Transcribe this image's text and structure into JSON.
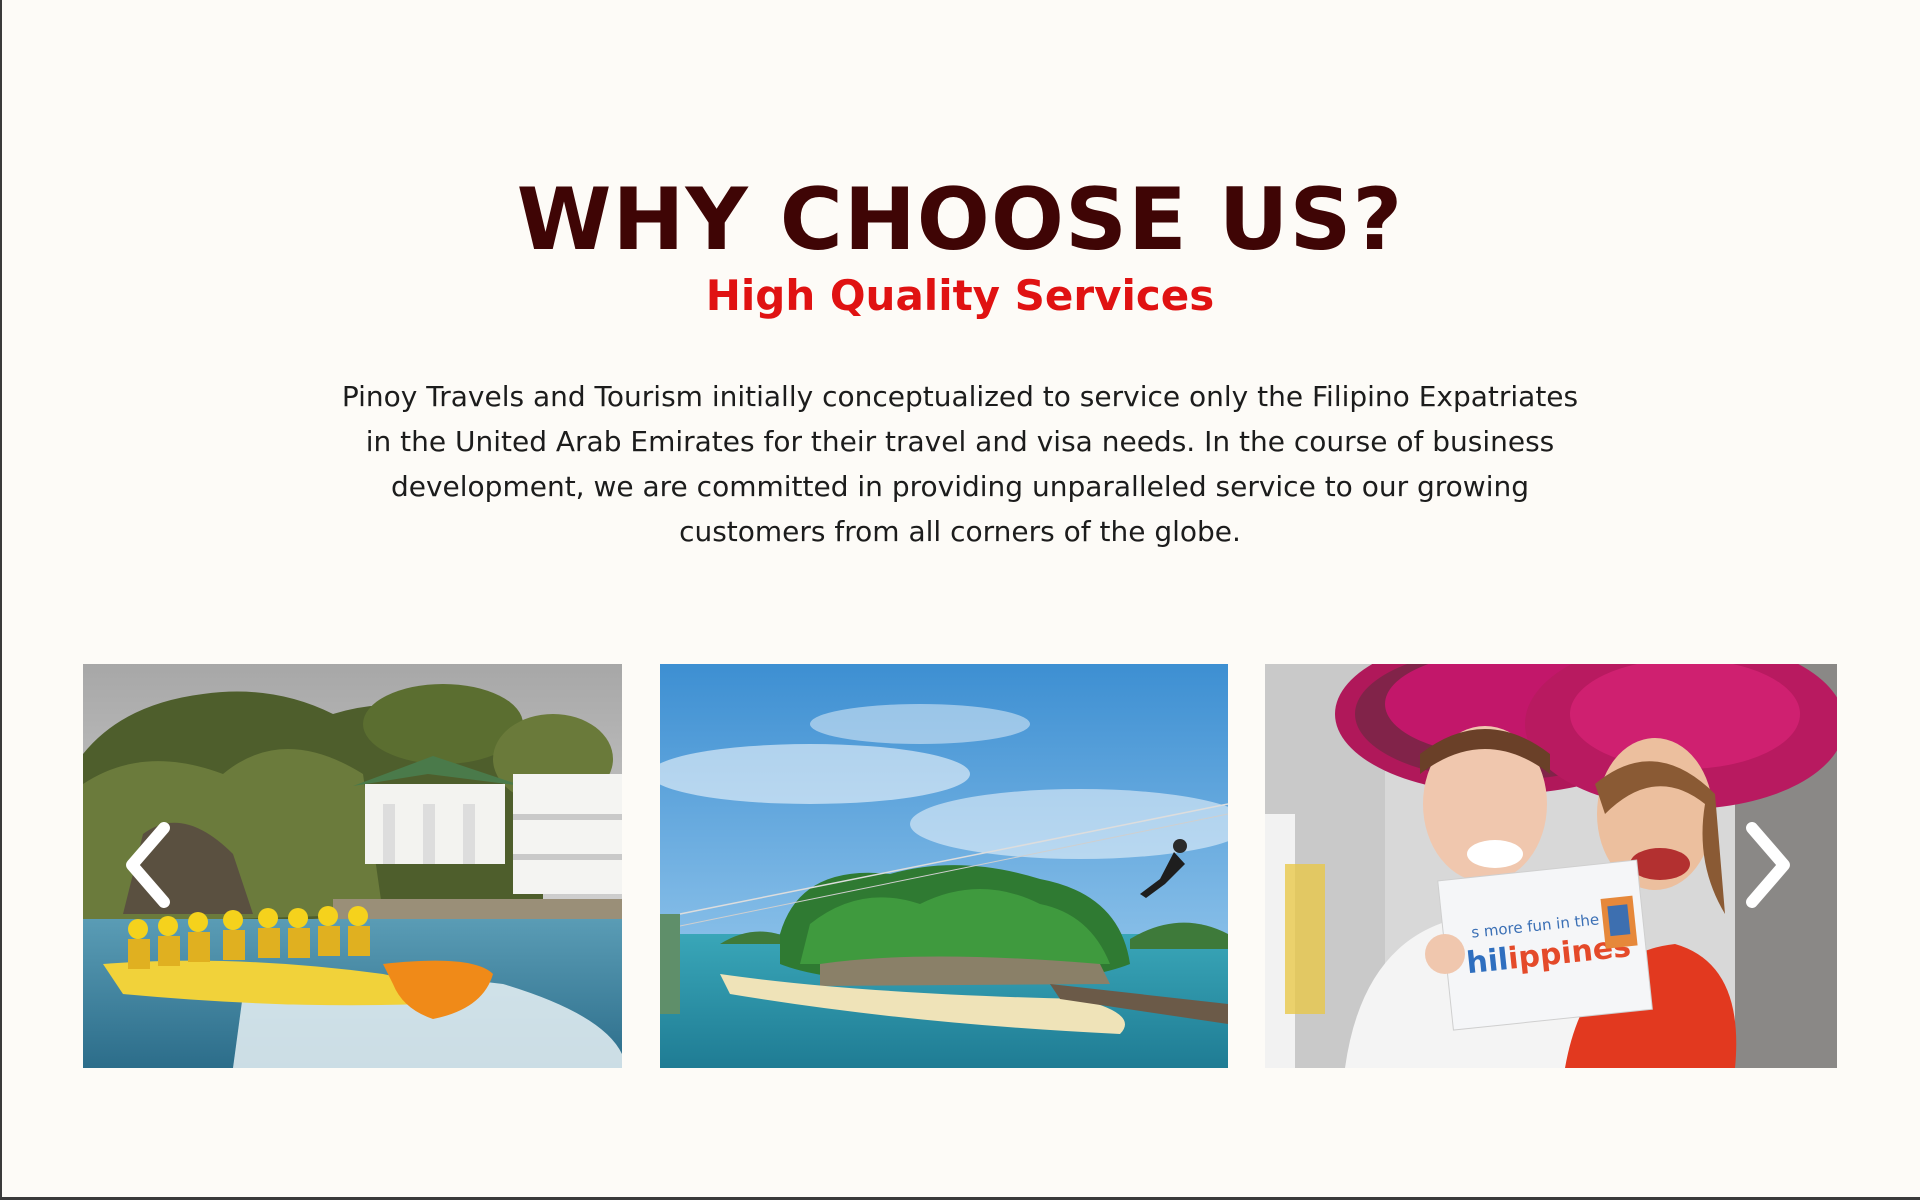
{
  "section": {
    "title": "WHY CHOOSE US?",
    "subtitle": "High Quality Services",
    "description": "Pinoy Travels and Tourism initially conceptualized to service only the Filipino Expatriates in the United Arab Emirates for their travel and visa needs. In the course of business development, we are committed in providing unparalleled service to our growing customers from all corners of the globe."
  },
  "carousel": {
    "prev_icon": "chevron-left-icon",
    "next_icon": "chevron-right-icon",
    "slides": [
      {
        "image": "banana-boat-ride-photo"
      },
      {
        "image": "island-zipline-photo"
      },
      {
        "image": "tourists-with-sign-photo",
        "sign_text": "It's more fun in the Philippines"
      }
    ]
  },
  "colors": {
    "background": "#fdfbf7",
    "title": "#3f0505",
    "subtitle": "#e01212",
    "body_text": "#1c1c1c"
  }
}
